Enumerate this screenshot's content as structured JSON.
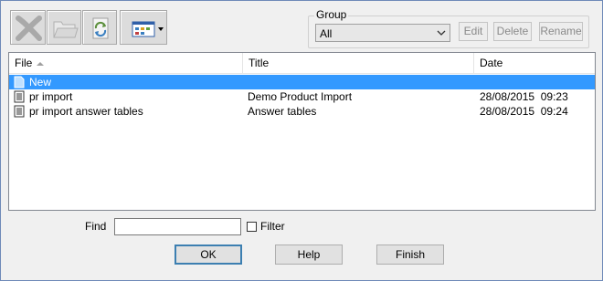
{
  "toolbar": {
    "delete_icon": "x-icon",
    "folder_icon": "folder-icon",
    "refresh_icon": "refresh-icon",
    "view_icon": "view-options-icon"
  },
  "group": {
    "label": "Group",
    "selected": "All",
    "edit": "Edit",
    "delete": "Delete",
    "rename": "Rename"
  },
  "list": {
    "columns": [
      "File",
      "Title",
      "Date"
    ],
    "rows": [
      {
        "file": "New",
        "title": "",
        "date": "",
        "icon": "new-file-icon"
      },
      {
        "file": "pr import",
        "title": "Demo Product Import",
        "date": "28/08/2015  09:23",
        "icon": "document-icon"
      },
      {
        "file": "pr import answer tables",
        "title": "Answer tables",
        "date": "28/08/2015  09:24",
        "icon": "document-icon"
      }
    ]
  },
  "find": {
    "label": "Find",
    "value": ""
  },
  "filter": {
    "label": "Filter",
    "checked": false
  },
  "buttons": {
    "ok": "OK",
    "help": "Help",
    "finish": "Finish"
  },
  "colors": {
    "selection": "#3399ff",
    "window_border": "#6f8ab8"
  }
}
